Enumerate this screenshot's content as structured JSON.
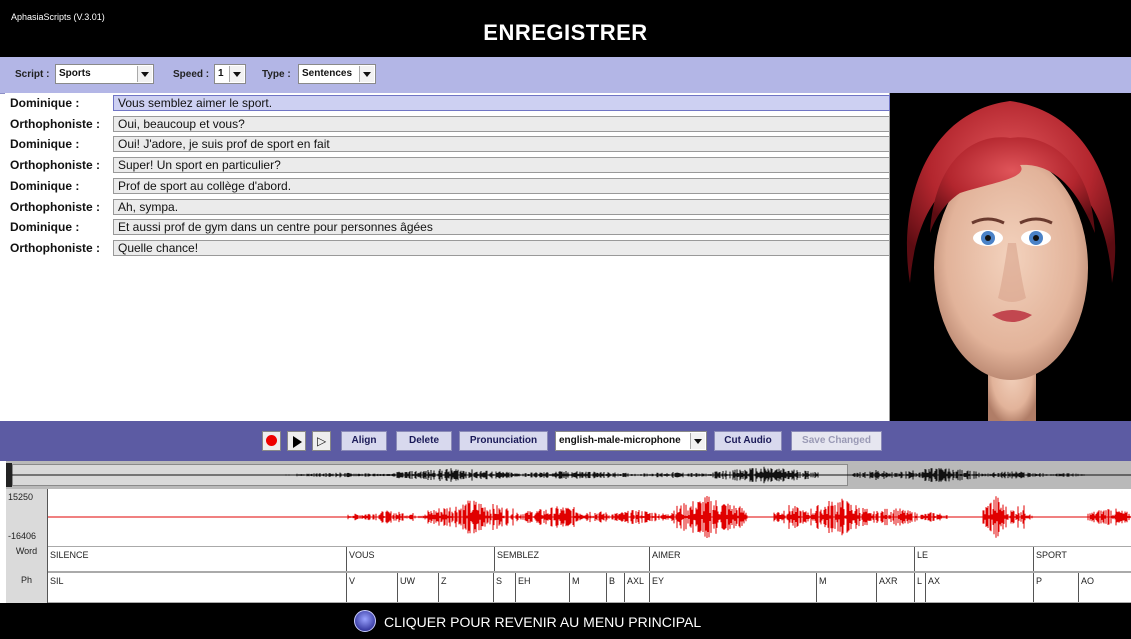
{
  "app": {
    "version": "AphasiaScripts (V.3.01)",
    "title": "ENREGISTRER"
  },
  "toolbar": {
    "script_label": "Script :",
    "script_value": "Sports",
    "speed_label": "Speed :",
    "speed_value": "1",
    "type_label": "Type :",
    "type_value": "Sentences"
  },
  "dialogue": [
    {
      "speaker": "Dominique :",
      "text": "Vous semblez aimer le sport.",
      "selected": true
    },
    {
      "speaker": "Orthophoniste :",
      "text": "Oui, beaucoup et vous?"
    },
    {
      "speaker": "Dominique :",
      "text": "Oui! J'adore, je suis prof de sport en fait"
    },
    {
      "speaker": "Orthophoniste :",
      "text": "Super! Un sport en particulier?"
    },
    {
      "speaker": "Dominique :",
      "text": "Prof de sport au collège d'abord."
    },
    {
      "speaker": "Orthophoniste :",
      "text": "Ah, sympa."
    },
    {
      "speaker": "Dominique :",
      "text": "Et aussi prof de gym dans un centre pour personnes âgées"
    },
    {
      "speaker": "Orthophoniste :",
      "text": "Quelle chance!"
    }
  ],
  "controls": {
    "align": "Align",
    "delete": "Delete",
    "pronunciation": "Pronunciation",
    "voice": "english-male-microphone",
    "cut_audio": "Cut Audio",
    "save_changed": "Save Changed"
  },
  "waveform": {
    "y_max": "15250",
    "y_min": "-16406",
    "word_label": "Word",
    "ph_label": "Ph",
    "words": [
      "SILENCE",
      "VOUS",
      "SEMBLEZ",
      "AIMER",
      "LE",
      "SPORT"
    ],
    "phonemes": [
      "SIL",
      "V",
      "UW",
      "Z",
      "S",
      "EH",
      "M",
      "B",
      "AXL",
      "EY",
      "M",
      "AXR",
      "L",
      "AX",
      "P",
      "AO"
    ]
  },
  "footer": {
    "label": "CLIQUER POUR REVENIR AU MENU PRINCIPAL"
  },
  "colors": {
    "toolbar": "#b3b6e6",
    "controlbar": "#5c5ba3",
    "waveform": "#e00000",
    "selection": "#cdd0f2"
  }
}
